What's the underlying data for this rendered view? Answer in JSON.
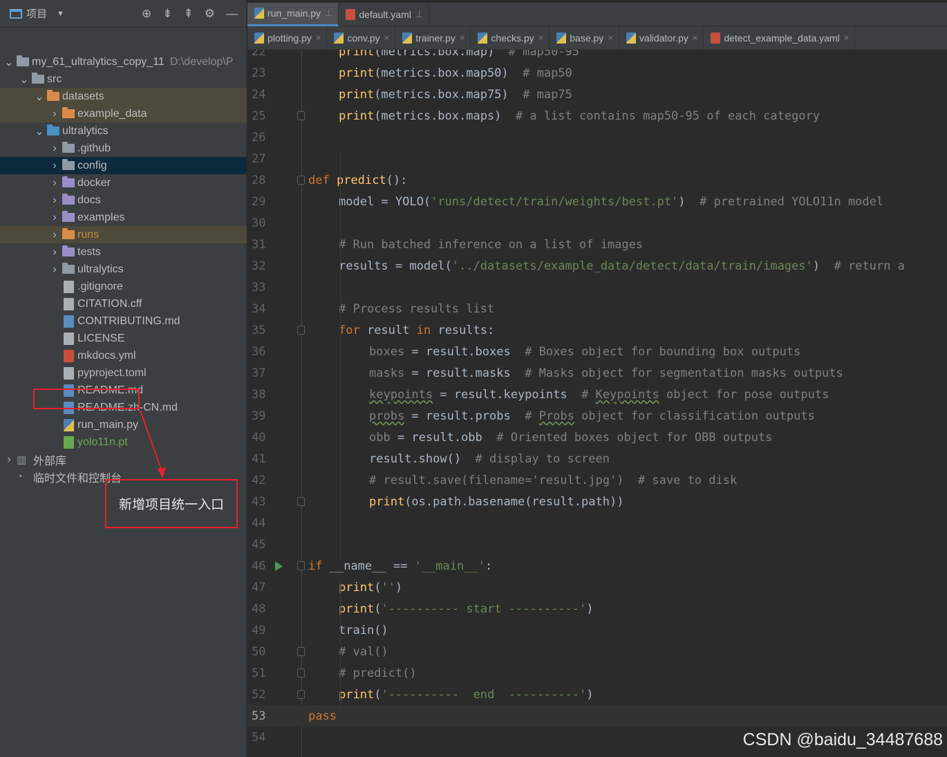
{
  "project_panel": {
    "title": "项目",
    "tree": [
      {
        "label": "my_61_ultralytics_copy_11",
        "suffix": "D:\\develop\\P",
        "indent": 0,
        "type": "folder",
        "color": "grey",
        "expanded": true
      },
      {
        "label": "src",
        "indent": 1,
        "type": "folder",
        "color": "grey",
        "expanded": true
      },
      {
        "label": "datasets",
        "indent": 2,
        "type": "folder",
        "color": "orange",
        "expanded": true,
        "highlight": "excluded"
      },
      {
        "label": "example_data",
        "indent": 3,
        "type": "folder",
        "color": "orange",
        "expanded": false,
        "highlight": "excluded"
      },
      {
        "label": "ultralytics",
        "indent": 2,
        "type": "folder",
        "color": "blue",
        "expanded": true
      },
      {
        "label": ".github",
        "indent": 3,
        "type": "folder",
        "color": "grey",
        "expanded": false
      },
      {
        "label": "config",
        "indent": 3,
        "type": "folder",
        "color": "grey",
        "expanded": false,
        "highlight": "selected"
      },
      {
        "label": "docker",
        "indent": 3,
        "type": "folder",
        "color": "purple",
        "expanded": false
      },
      {
        "label": "docs",
        "indent": 3,
        "type": "folder",
        "color": "purple",
        "expanded": false
      },
      {
        "label": "examples",
        "indent": 3,
        "type": "folder",
        "color": "purple",
        "expanded": false
      },
      {
        "label": "runs",
        "indent": 3,
        "type": "folder",
        "color": "orange",
        "expanded": false,
        "highlight": "excluded"
      },
      {
        "label": "tests",
        "indent": 3,
        "type": "folder",
        "color": "purple",
        "expanded": false
      },
      {
        "label": "ultralytics",
        "indent": 3,
        "type": "folder",
        "color": "grey",
        "expanded": false
      },
      {
        "label": ".gitignore",
        "indent": 3,
        "type": "file",
        "ftype": "txt"
      },
      {
        "label": "CITATION.cff",
        "indent": 3,
        "type": "file",
        "ftype": "txt"
      },
      {
        "label": "CONTRIBUTING.md",
        "indent": 3,
        "type": "file",
        "ftype": "md"
      },
      {
        "label": "LICENSE",
        "indent": 3,
        "type": "file",
        "ftype": "txt"
      },
      {
        "label": "mkdocs.yml",
        "indent": 3,
        "type": "file",
        "ftype": "yml"
      },
      {
        "label": "pyproject.toml",
        "indent": 3,
        "type": "file",
        "ftype": "txt"
      },
      {
        "label": "README.md",
        "indent": 3,
        "type": "file",
        "ftype": "md"
      },
      {
        "label": "README.zh-CN.md",
        "indent": 3,
        "type": "file",
        "ftype": "md"
      },
      {
        "label": "run_main.py",
        "indent": 3,
        "type": "file",
        "ftype": "py"
      },
      {
        "label": "yolo11n.pt",
        "indent": 3,
        "type": "file",
        "ftype": "pt"
      },
      {
        "label": "外部库",
        "indent": 0,
        "type": "lib",
        "expanded": false
      },
      {
        "label": "临时文件和控制台",
        "indent": 0,
        "type": "scratch"
      }
    ],
    "annotation": "新增项目统一入口"
  },
  "tabs_row1": [
    {
      "label": "run_main.py",
      "icon": "py",
      "active": true,
      "pinned": true
    },
    {
      "label": "default.yaml",
      "icon": "yml",
      "active": false,
      "pinned": true
    }
  ],
  "tabs_row2": [
    {
      "label": "plotting.py",
      "icon": "py"
    },
    {
      "label": "conv.py",
      "icon": "py"
    },
    {
      "label": "trainer.py",
      "icon": "py"
    },
    {
      "label": "checks.py",
      "icon": "py"
    },
    {
      "label": "base.py",
      "icon": "py"
    },
    {
      "label": "validator.py",
      "icon": "py"
    },
    {
      "label": "detect_example_data.yaml",
      "icon": "yml"
    }
  ],
  "code_lines": [
    {
      "n": "22",
      "indent": 1,
      "tokens": [
        [
          "fn",
          "print"
        ],
        [
          "",
          "(metrics.box.map)  "
        ],
        [
          "cmt",
          "# map50-95"
        ]
      ]
    },
    {
      "n": "23",
      "indent": 1,
      "tokens": [
        [
          "fn",
          "print"
        ],
        [
          "",
          "(metrics.box.map50)  "
        ],
        [
          "cmt",
          "# map50"
        ]
      ]
    },
    {
      "n": "24",
      "indent": 1,
      "tokens": [
        [
          "fn",
          "print"
        ],
        [
          "",
          "(metrics.box.map75)  "
        ],
        [
          "cmt",
          "# map75"
        ]
      ]
    },
    {
      "n": "25",
      "indent": 1,
      "fold": true,
      "tokens": [
        [
          "fn",
          "print"
        ],
        [
          "",
          "(metrics.box.maps)  "
        ],
        [
          "cmt",
          "# a list contains map50-95 of each category"
        ]
      ]
    },
    {
      "n": "26",
      "indent": 0,
      "tokens": []
    },
    {
      "n": "27",
      "indent": 0,
      "tokens": []
    },
    {
      "n": "28",
      "indent": 0,
      "fold": true,
      "tokens": [
        [
          "kw",
          "def "
        ],
        [
          "fn",
          "predict"
        ],
        [
          "",
          "():"
        ]
      ]
    },
    {
      "n": "29",
      "indent": 1,
      "tokens": [
        [
          "",
          "model = YOLO("
        ],
        [
          "str",
          "'runs/detect/train/weights/best.pt'"
        ],
        [
          "",
          ")  "
        ],
        [
          "cmt",
          "# pretrained YOLO11n model"
        ]
      ]
    },
    {
      "n": "30",
      "indent": 0,
      "tokens": []
    },
    {
      "n": "31",
      "indent": 1,
      "tokens": [
        [
          "cmt",
          "# Run batched inference on a list of images"
        ]
      ]
    },
    {
      "n": "32",
      "indent": 1,
      "tokens": [
        [
          "",
          "results = model("
        ],
        [
          "str",
          "'../datasets/example_data/detect/data/train/images'"
        ],
        [
          "",
          ")  "
        ],
        [
          "cmt",
          "# return a"
        ]
      ]
    },
    {
      "n": "33",
      "indent": 0,
      "tokens": []
    },
    {
      "n": "34",
      "indent": 1,
      "tokens": [
        [
          "cmt",
          "# Process results list"
        ]
      ]
    },
    {
      "n": "35",
      "indent": 1,
      "fold": true,
      "tokens": [
        [
          "kw",
          "for "
        ],
        [
          "",
          "result "
        ],
        [
          "kw",
          "in "
        ],
        [
          "",
          "results:"
        ]
      ]
    },
    {
      "n": "36",
      "indent": 2,
      "tokens": [
        [
          "cmt",
          "boxes"
        ],
        [
          "",
          " = result.boxes  "
        ],
        [
          "cmt",
          "# Boxes object for bounding box outputs"
        ]
      ]
    },
    {
      "n": "37",
      "indent": 2,
      "tokens": [
        [
          "cmt",
          "masks"
        ],
        [
          "",
          " = result.masks  "
        ],
        [
          "cmt",
          "# Masks object for segmentation masks outputs"
        ]
      ]
    },
    {
      "n": "38",
      "indent": 2,
      "tokens": [
        [
          "cmt squig",
          "keypoints"
        ],
        [
          "",
          " = result.keypoints  "
        ],
        [
          "cmt",
          "# "
        ],
        [
          "cmt squig",
          "Keypoints"
        ],
        [
          "cmt",
          " object for pose outputs"
        ]
      ]
    },
    {
      "n": "39",
      "indent": 2,
      "tokens": [
        [
          "cmt squig",
          "probs"
        ],
        [
          "",
          " = result.probs  "
        ],
        [
          "cmt",
          "# "
        ],
        [
          "cmt squig",
          "Probs"
        ],
        [
          "cmt",
          " object for classification outputs"
        ]
      ]
    },
    {
      "n": "40",
      "indent": 2,
      "tokens": [
        [
          "cmt",
          "obb"
        ],
        [
          "",
          " = result.obb  "
        ],
        [
          "cmt",
          "# Oriented boxes object for OBB outputs"
        ]
      ]
    },
    {
      "n": "41",
      "indent": 2,
      "tokens": [
        [
          "",
          "result.show()  "
        ],
        [
          "cmt",
          "# display to screen"
        ]
      ]
    },
    {
      "n": "42",
      "indent": 2,
      "tokens": [
        [
          "cmt",
          "# result.save(filename='result.jpg')  # save to disk"
        ]
      ]
    },
    {
      "n": "43",
      "indent": 2,
      "fold": true,
      "tokens": [
        [
          "fn",
          "print"
        ],
        [
          "",
          "(os.path.basename(result.path))"
        ]
      ]
    },
    {
      "n": "44",
      "indent": 0,
      "tokens": []
    },
    {
      "n": "45",
      "indent": 0,
      "tokens": []
    },
    {
      "n": "46",
      "indent": 0,
      "fold": true,
      "run": true,
      "tokens": [
        [
          "kw",
          "if "
        ],
        [
          "",
          "__name__ == "
        ],
        [
          "str",
          "'__main__'"
        ],
        [
          "",
          ":"
        ]
      ]
    },
    {
      "n": "47",
      "indent": 1,
      "tokens": [
        [
          "fn",
          "print"
        ],
        [
          "",
          "("
        ],
        [
          "str",
          "''"
        ],
        [
          "",
          ")"
        ]
      ]
    },
    {
      "n": "48",
      "indent": 1,
      "tokens": [
        [
          "fn",
          "print"
        ],
        [
          "",
          "("
        ],
        [
          "str",
          "'---------- start ----------'"
        ],
        [
          "",
          ")"
        ]
      ]
    },
    {
      "n": "49",
      "indent": 1,
      "tokens": [
        [
          "",
          "train()"
        ]
      ]
    },
    {
      "n": "50",
      "indent": 1,
      "fold": true,
      "tokens": [
        [
          "cmt",
          "# val()"
        ]
      ]
    },
    {
      "n": "51",
      "indent": 1,
      "fold": true,
      "tokens": [
        [
          "cmt",
          "# predict()"
        ]
      ]
    },
    {
      "n": "52",
      "indent": 1,
      "fold": true,
      "tokens": [
        [
          "fn",
          "print"
        ],
        [
          "",
          "("
        ],
        [
          "str",
          "'----------  end  ----------'"
        ],
        [
          "",
          ")"
        ]
      ]
    },
    {
      "n": "53",
      "indent": 0,
      "current": true,
      "tokens": [
        [
          "kw",
          "pass"
        ]
      ]
    },
    {
      "n": "54",
      "indent": 0,
      "tokens": []
    }
  ],
  "watermark": "CSDN @baidu_34487688"
}
